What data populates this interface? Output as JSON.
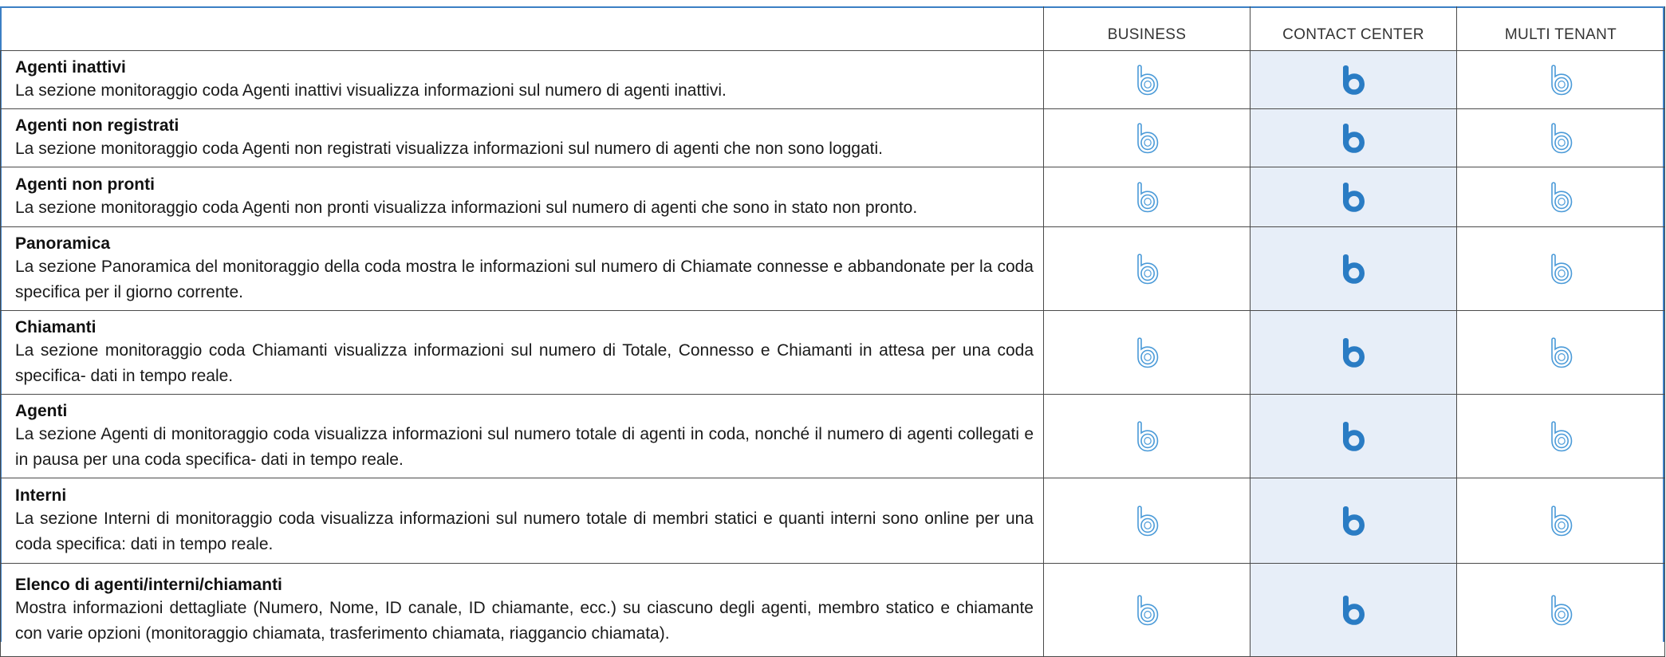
{
  "header": {
    "plans": [
      "BUSINESS",
      "CONTACT CENTER",
      "MULTI TENANT"
    ]
  },
  "colors": {
    "frame_border": "#3b7fc4",
    "highlight_column": "#e7eef8",
    "icon_outline": "#4a9ad8",
    "icon_filled": "#2a7cc4"
  },
  "icons": {
    "business": "brand-b-outline-icon",
    "contact_center": "brand-b-filled-icon",
    "multi_tenant": "brand-b-outline-icon"
  },
  "rows": [
    {
      "title": "Agenti inattivi",
      "description": "La sezione monitoraggio coda Agenti inattivi visualizza informazioni sul numero di agenti inattivi."
    },
    {
      "title": "Agenti non registrati",
      "description": "La sezione monitoraggio coda Agenti non registrati visualizza informazioni sul numero di agenti che non sono loggati."
    },
    {
      "title": "Agenti non pronti",
      "description": "La sezione monitoraggio coda Agenti non pronti visualizza informazioni sul numero di agenti che sono in stato non pronto."
    },
    {
      "title": "Panoramica",
      "description": "La sezione Panoramica del monitoraggio della coda mostra le informazioni sul numero di Chiamate connesse e abbandonate per la coda specifica per il giorno corrente."
    },
    {
      "title": "Chiamanti",
      "description": "La sezione monitoraggio coda Chiamanti visualizza informazioni sul numero di Totale, Connesso e Chiamanti in attesa per una coda specifica- dati in tempo reale."
    },
    {
      "title": "Agenti",
      "description": "La sezione Agenti di monitoraggio coda visualizza informazioni sul numero totale di agenti in coda, nonché il numero di agenti collegati e in pausa per una coda specifica- dati in tempo reale."
    },
    {
      "title": "Interni",
      "description": "La sezione Interni di monitoraggio coda visualizza informazioni sul numero totale di membri statici e quanti interni sono online per una coda specifica: dati in tempo reale."
    },
    {
      "title": "Elenco di agenti/interni/chiamanti",
      "description": "Mostra informazioni dettagliate (Numero, Nome, ID canale, ID chiamante, ecc.) su ciascuno degli agenti, membro statico e chiamante con varie opzioni (monitoraggio chiamata, trasferimento chiamata, riaggancio chiamata)."
    }
  ]
}
